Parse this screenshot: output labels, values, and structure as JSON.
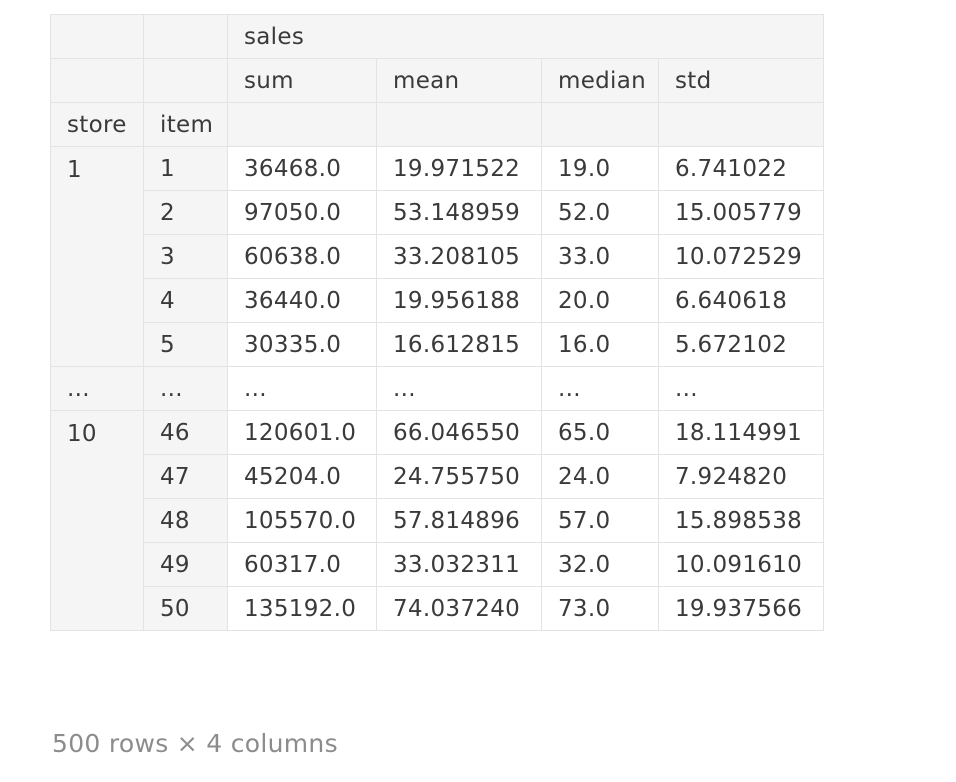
{
  "table": {
    "top_header": "sales",
    "stat_headers": [
      "sum",
      "mean",
      "median",
      "std"
    ],
    "index_names": [
      "store",
      "item"
    ],
    "groups": [
      {
        "store": "1",
        "rows": [
          {
            "item": "1",
            "sum": "36468.0",
            "mean": "19.971522",
            "median": "19.0",
            "std": "6.741022"
          },
          {
            "item": "2",
            "sum": "97050.0",
            "mean": "53.148959",
            "median": "52.0",
            "std": "15.005779"
          },
          {
            "item": "3",
            "sum": "60638.0",
            "mean": "33.208105",
            "median": "33.0",
            "std": "10.072529"
          },
          {
            "item": "4",
            "sum": "36440.0",
            "mean": "19.956188",
            "median": "20.0",
            "std": "6.640618"
          },
          {
            "item": "5",
            "sum": "30335.0",
            "mean": "16.612815",
            "median": "16.0",
            "std": "5.672102"
          }
        ]
      },
      {
        "store": "10",
        "rows": [
          {
            "item": "46",
            "sum": "120601.0",
            "mean": "66.046550",
            "median": "65.0",
            "std": "18.114991"
          },
          {
            "item": "47",
            "sum": "45204.0",
            "mean": "24.755750",
            "median": "24.0",
            "std": "7.924820"
          },
          {
            "item": "48",
            "sum": "105570.0",
            "mean": "57.814896",
            "median": "57.0",
            "std": "15.898538"
          },
          {
            "item": "49",
            "sum": "60317.0",
            "mean": "33.032311",
            "median": "32.0",
            "std": "10.091610"
          },
          {
            "item": "50",
            "sum": "135192.0",
            "mean": "74.037240",
            "median": "73.0",
            "std": "19.937566"
          }
        ]
      }
    ],
    "ellipsis": "..."
  },
  "footer": "500 rows × 4 columns"
}
